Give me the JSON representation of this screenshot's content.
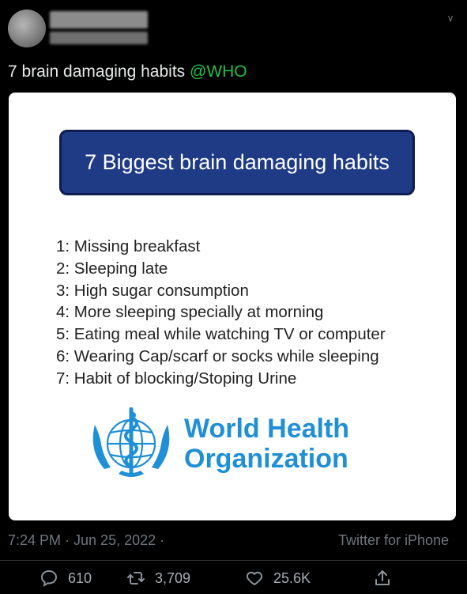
{
  "tweet": {
    "text_main": "7 brain damaging habits ",
    "mention": "@WHO",
    "timestamp": "7:24 PM · Jun 25, 2022 ·",
    "source": "Twitter for iPhone"
  },
  "image": {
    "banner_title": "7 Biggest brain damaging habits",
    "habits": [
      "1: Missing breakfast",
      "2: Sleeping late",
      "3: High sugar consumption",
      "4: More sleeping specially at morning",
      "5: Eating meal while watching TV or computer",
      "6: Wearing Cap/scarf or socks while sleeping",
      "7: Habit of blocking/Stoping Urine"
    ],
    "org_name_line1": "World Health",
    "org_name_line2": "Organization"
  },
  "actions": {
    "replies": "610",
    "retweets": "3,709",
    "likes": "25.6K"
  },
  "colors": {
    "mention": "#1fbf4a",
    "banner_bg": "#1f3b86",
    "who_blue": "#1f8fd6",
    "muted": "#6e767d"
  },
  "icons": {
    "header_menu": "chevron-down-icon",
    "reply": "reply-icon",
    "retweet": "retweet-icon",
    "like": "heart-icon",
    "share": "share-icon",
    "logo": "who-emblem-icon"
  }
}
